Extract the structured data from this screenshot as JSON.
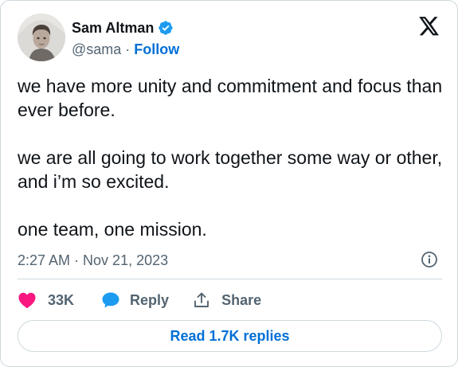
{
  "author": {
    "name": "Sam Altman",
    "handle": "@sama",
    "separator": "·",
    "follow_label": "Follow",
    "verified": true,
    "verified_color": "#1d9bf0"
  },
  "platform_icon": "x-logo-icon",
  "tweet": {
    "paragraphs": [
      "we have more unity and commitment and focus than ever before.",
      "we are all going to work together some way or other, and i’m so excited.",
      "one team, one mission."
    ]
  },
  "meta": {
    "time": "2:27 AM",
    "separator": "·",
    "date": "Nov 21, 2023",
    "info_icon": "info-icon"
  },
  "actions": {
    "like": {
      "icon": "heart-icon",
      "count": "33K",
      "color": "#f91880"
    },
    "reply": {
      "icon": "speech-bubble-icon",
      "label": "Reply",
      "color": "#1d9bf0"
    },
    "share": {
      "icon": "upload-share-icon",
      "label": "Share"
    }
  },
  "read_replies": {
    "label": "Read 1.7K replies"
  },
  "colors": {
    "text": "#0f1419",
    "secondary": "#536471",
    "link": "#006fd6",
    "border": "#cfd9de"
  }
}
